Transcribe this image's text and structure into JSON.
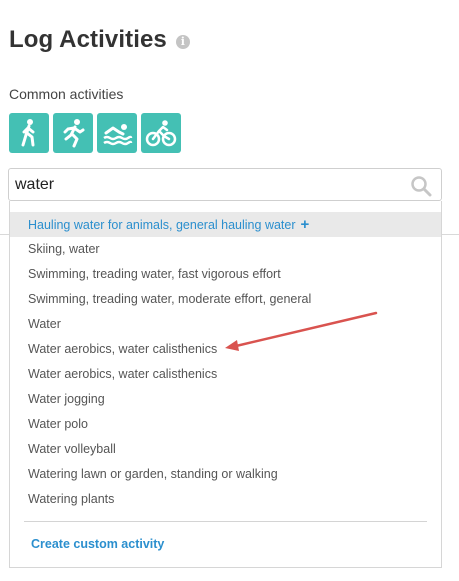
{
  "page": {
    "title": "Log Activities",
    "info_icon": "i"
  },
  "common_activities": {
    "label": "Common activities",
    "buttons": [
      {
        "icon": "walking-icon"
      },
      {
        "icon": "running-icon"
      },
      {
        "icon": "swimming-icon"
      },
      {
        "icon": "cycling-icon"
      }
    ]
  },
  "search": {
    "value": "water",
    "icon": "search-icon"
  },
  "results": {
    "highlighted": {
      "label": "Hauling water for animals, general hauling water",
      "add_icon": "+"
    },
    "items": [
      "Skiing, water",
      "Swimming, treading water, fast vigorous effort",
      "Swimming, treading water, moderate effort, general",
      "Water",
      "Water aerobics, water calisthenics",
      "Water aerobics, water calisthenics",
      "Water jogging",
      "Water polo",
      "Water volleyball",
      "Watering lawn or garden, standing or walking",
      "Watering plants"
    ],
    "create_link": "Create custom activity"
  },
  "colors": {
    "accent": "#44c0b4",
    "link": "#2b8fce",
    "arrow": "#d9534f"
  }
}
